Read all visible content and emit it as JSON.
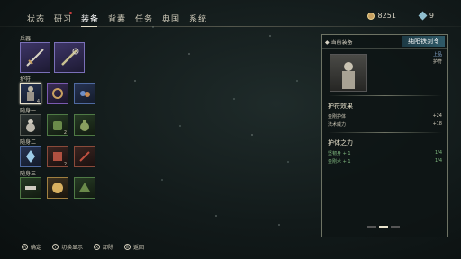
{
  "nav": {
    "tabs": [
      "状态",
      "研习",
      "装备",
      "背囊",
      "任务",
      "典国",
      "系统"
    ],
    "active_index": 2,
    "notification_on": 1
  },
  "currency": {
    "coins": "8251",
    "gems": "9"
  },
  "left": {
    "weapon_label": "兵器",
    "weapon_badges": [
      "",
      ""
    ],
    "amulet_label": "护符",
    "accessory1_label": "随身一",
    "accessory1_badges": [
      "4",
      "",
      ""
    ],
    "accessory2_label": "随身二",
    "accessory2_badges": [
      "",
      "2",
      ""
    ],
    "accessory3_label": "随身三",
    "accessory3_badges": [
      "",
      "2",
      ""
    ],
    "accessory4_badges": [
      "",
      "",
      ""
    ]
  },
  "detail": {
    "header_left": "◆ 当前装备",
    "item_name": "纯阳铁剑令",
    "grade": "上品",
    "type": "护符",
    "effect_title": "护符效果",
    "effects": [
      {
        "name": "金刚护体",
        "value": "+24"
      },
      {
        "name": "法术威力",
        "value": "+18"
      }
    ],
    "power_title": "护体之力",
    "powers": [
      {
        "name": "坚韧身 + 1",
        "value": "1/4"
      },
      {
        "name": "金刚术 + 1",
        "value": "1/4"
      }
    ],
    "pager_active": 1
  },
  "hints": [
    {
      "key": "A",
      "label": "确定"
    },
    {
      "key": "Y",
      "label": "切换显示"
    },
    {
      "key": "X",
      "label": "卸除"
    },
    {
      "key": "B",
      "label": "返回"
    }
  ],
  "colors": {
    "accent": "#e8e2cc",
    "panel_border": "#6e7364",
    "name_bg": "#2f5a68",
    "green_stat": "#7fb87f"
  }
}
